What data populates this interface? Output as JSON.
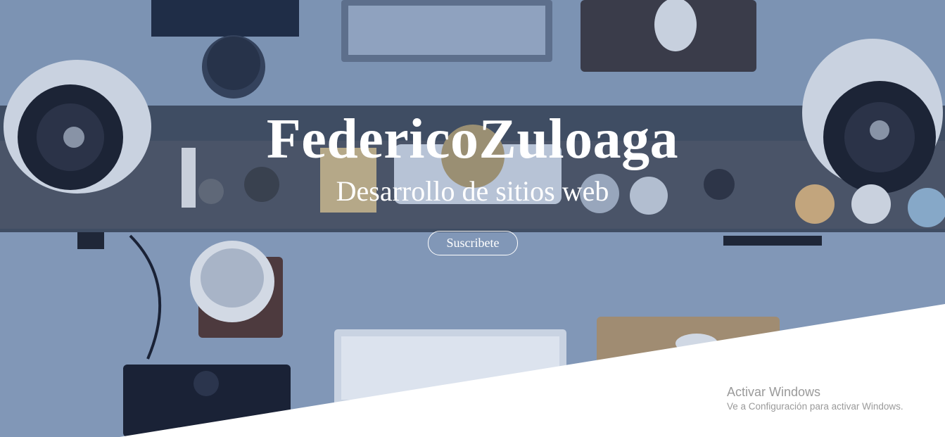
{
  "hero": {
    "title": "FedericoZuloaga",
    "subtitle": "Desarrollo de sitios web",
    "cta_label": "Suscribete",
    "overlay_color": "#2c4a7a",
    "background_image": "desk-workspace-photo"
  },
  "windows_activation": {
    "title": "Activar Windows",
    "message": "Ve a Configuración para activar Windows."
  }
}
